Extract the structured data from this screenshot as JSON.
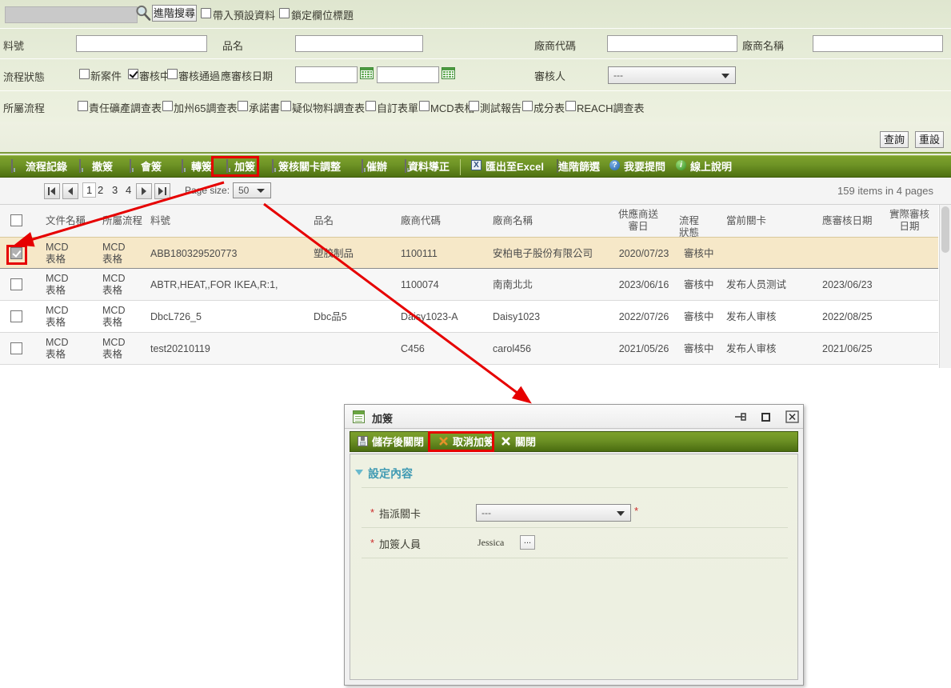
{
  "search": {
    "keyword_value": "",
    "advanced_search_button": "進階搜尋",
    "checkbox_default_data": "帶入預設資料",
    "checkbox_lock_header": "鎖定欄位標題",
    "magnifier_icon": "search-icon",
    "fields": {
      "part_no_label": "料號",
      "part_no_value": "",
      "product_name_label": "品名",
      "product_name_value": "",
      "vendor_code_label": "廠商代碼",
      "vendor_code_value": "",
      "vendor_name_label": "廠商名稱",
      "vendor_name_value": "",
      "flow_status_label": "流程狀態",
      "flow_status_options": [
        "新案件",
        "審核中",
        "審核通過"
      ],
      "flow_status_checked": [
        false,
        true,
        false
      ],
      "due_date_label": "應審核日期",
      "due_date_from": "",
      "due_date_to": "",
      "reviewer_label": "審核人",
      "reviewer_value": "---",
      "belong_flow_label": "所屬流程",
      "belong_flow_options": [
        "責任礦產調查表",
        "加州65調查表",
        "承諾書",
        "疑似物料調查表",
        "自訂表單",
        "MCD表格",
        "測試報告",
        "成分表",
        "REACH調查表"
      ]
    },
    "query_button": "查詢",
    "reset_button": "重設"
  },
  "toolbar": {
    "items": [
      {
        "label": "流程記錄",
        "icon": "disk-icon"
      },
      {
        "label": "撤簽",
        "icon": "disk-icon"
      },
      {
        "label": "會簽",
        "icon": "disk-icon"
      },
      {
        "label": "轉簽",
        "icon": "disk-icon"
      },
      {
        "label": "加簽",
        "icon": "disk-icon"
      },
      {
        "label": "簽核關卡調整",
        "icon": "disk-icon"
      },
      {
        "label": "催辦",
        "icon": "disk-icon"
      },
      {
        "label": "資料導正",
        "icon": "disk-icon"
      },
      {
        "label": "匯出至Excel",
        "icon": "excel-icon"
      },
      {
        "label": "進階篩選",
        "icon": "filter-icon"
      },
      {
        "label": "我要提問",
        "icon": "question-icon"
      },
      {
        "label": "線上說明",
        "icon": "info-icon"
      }
    ]
  },
  "pager": {
    "first_icon": "first-page-icon",
    "prev_icon": "prev-page-icon",
    "next_icon": "next-page-icon",
    "last_icon": "last-page-icon",
    "pages": [
      "1",
      "2",
      "3",
      "4"
    ],
    "active_page": "1",
    "page_size_label": "Page size:",
    "page_size_value": "50",
    "items_info": "159 items in 4 pages"
  },
  "grid": {
    "columns": [
      "文件名稱",
      "所屬流程",
      "料號",
      "品名",
      "廠商代碼",
      "廠商名稱",
      "供應商送審日",
      "流程狀態",
      "當前關卡",
      "應審核日期",
      "實際審核日期"
    ],
    "rows": [
      {
        "checked": true,
        "doc_name": "MCD表格",
        "flow": "MCD表格",
        "part_no": "ABB180329520773",
        "product_name": "塑胶制品",
        "vendor_code": "1100111",
        "vendor_name": "安柏电子股份有限公司",
        "submit_date": "2020/07/23",
        "status": "審核中",
        "current_node": "",
        "due_date": "",
        "actual_date": ""
      },
      {
        "checked": false,
        "doc_name": "MCD表格",
        "flow": "MCD表格",
        "part_no": "ABTR,HEAT,,FOR IKEA,R:1,",
        "product_name": "",
        "vendor_code": "1100074",
        "vendor_name": "南南北北",
        "submit_date": "2023/06/16",
        "status": "審核中",
        "current_node": "发布人员测试",
        "due_date": "2023/06/23",
        "actual_date": ""
      },
      {
        "checked": false,
        "doc_name": "MCD表格",
        "flow": "MCD表格",
        "part_no": "DbcL726_5",
        "product_name": "Dbc品5",
        "vendor_code": "Daisy1023-A",
        "vendor_name": "Daisy1023",
        "submit_date": "2022/07/26",
        "status": "審核中",
        "current_node": "发布人审核",
        "due_date": "2022/08/25",
        "actual_date": ""
      },
      {
        "checked": false,
        "doc_name": "MCD表格",
        "flow": "MCD表格",
        "part_no": "test20210119",
        "product_name": "",
        "vendor_code": "C456",
        "vendor_name": "carol456",
        "submit_date": "2021/05/26",
        "status": "審核中",
        "current_node": "发布人审核",
        "due_date": "2021/06/25",
        "actual_date": ""
      }
    ]
  },
  "dialog": {
    "title": "加簽",
    "title_icon": "form-icon",
    "window_buttons": [
      "pin-icon",
      "maximize-icon",
      "close-icon"
    ],
    "toolbar": [
      {
        "label": "儲存後關閉",
        "icon": "save-icon"
      },
      {
        "label": "取消加簽",
        "icon": "cancel-icon"
      },
      {
        "label": "關閉",
        "icon": "close-x-icon"
      }
    ],
    "section_title": "設定內容",
    "fields": [
      {
        "required": "*",
        "label": "指派關卡",
        "type": "select",
        "value": "---",
        "trailing_required": "*"
      },
      {
        "required": "*",
        "label": "加簽人員",
        "type": "picker",
        "value": "Jessica",
        "picker_button": "..."
      }
    ]
  },
  "annotations": {
    "highlight_toolbar_item": "加簽",
    "highlight_row_checkbox": "row-1-checkbox",
    "highlight_dialog_button": "取消加簽",
    "accent_red": "#e60000",
    "accent_green": "#6f9426",
    "selected_row_bg": "#f6e8c8"
  }
}
